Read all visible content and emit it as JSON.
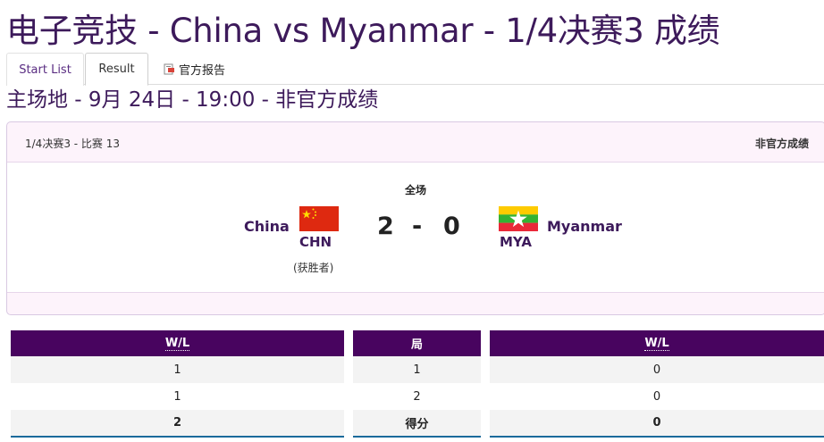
{
  "page": {
    "title": "电子竞技 - China vs Myanmar - 1/4决赛3 成绩",
    "subtitle": "主场地 - 9月 24日 - 19:00 - 非官方成绩"
  },
  "tabs": {
    "start_list": "Start List",
    "result": "Result",
    "report": "官方报告"
  },
  "match": {
    "header_left": "1/4决赛3 - 比赛 13",
    "header_right": "非官方成绩",
    "period": "全场",
    "team_a": {
      "name": "China",
      "code": "CHN",
      "note": "(获胜者)",
      "score": "2"
    },
    "team_b": {
      "name": "Myanmar",
      "code": "MYA",
      "score": "0"
    },
    "separator": "-"
  },
  "tables": {
    "left": {
      "header": "W/L",
      "rows": [
        "1",
        "1"
      ],
      "total": "2"
    },
    "middle": {
      "header": "局",
      "rows": [
        "1",
        "2"
      ],
      "total": "得分"
    },
    "right": {
      "header": "W/L",
      "rows": [
        "0",
        "0"
      ],
      "total": "0"
    }
  },
  "colors": {
    "brand_purple": "#48045f",
    "title_purple": "#3d1a5b",
    "card_tint": "#fdf3fb",
    "accent_blue": "#1a6a9b"
  },
  "icons": [
    "pdf-report-icon",
    "china-flag-icon",
    "myanmar-flag-icon"
  ]
}
